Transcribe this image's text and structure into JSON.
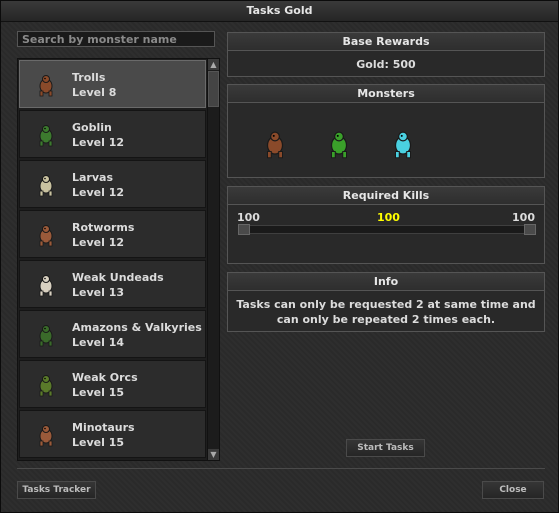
{
  "window": {
    "title": "Tasks Gold"
  },
  "search": {
    "placeholder": "Search by monster name"
  },
  "monsters_list": [
    {
      "name": "Trolls",
      "level": "Level 8",
      "icon": "troll-icon",
      "color": "#8a4a2a",
      "selected": true
    },
    {
      "name": "Goblin",
      "level": "Level 12",
      "icon": "goblin-icon",
      "color": "#3c7a2e",
      "selected": false
    },
    {
      "name": "Larvas",
      "level": "Level 12",
      "icon": "larva-icon",
      "color": "#c9c2a0",
      "selected": false
    },
    {
      "name": "Rotworms",
      "level": "Level 12",
      "icon": "rotworm-icon",
      "color": "#9a5a3a",
      "selected": false
    },
    {
      "name": "Weak Undeads",
      "level": "Level 13",
      "icon": "skeleton-icon",
      "color": "#d8d0c0",
      "selected": false
    },
    {
      "name": "Amazons & Valkyries",
      "level": "Level 14",
      "icon": "amazon-icon",
      "color": "#3a6a2a",
      "selected": false
    },
    {
      "name": "Weak Orcs",
      "level": "Level 15",
      "icon": "orc-icon",
      "color": "#5a7a2a",
      "selected": false
    },
    {
      "name": "Minotaurs",
      "level": "Level 15",
      "icon": "minotaur-icon",
      "color": "#9a5a3a",
      "selected": false
    }
  ],
  "base_rewards": {
    "title": "Base Rewards",
    "text": "Gold: 500"
  },
  "monsters_panel": {
    "title": "Monsters",
    "icons": [
      {
        "icon": "troll-icon",
        "color": "#8a4a2a"
      },
      {
        "icon": "goblin-icon",
        "color": "#3aa02a"
      },
      {
        "icon": "frost-troll-icon",
        "color": "#4ad0e0"
      }
    ]
  },
  "required_kills": {
    "title": "Required Kills",
    "min": "100",
    "current": "100",
    "max": "100"
  },
  "info": {
    "title": "Info",
    "text": "Tasks can only be requested 2 at same time and can only be repeated 2 times each."
  },
  "buttons": {
    "start": "Start Tasks",
    "tracker": "Tasks Tracker",
    "close": "Close"
  }
}
